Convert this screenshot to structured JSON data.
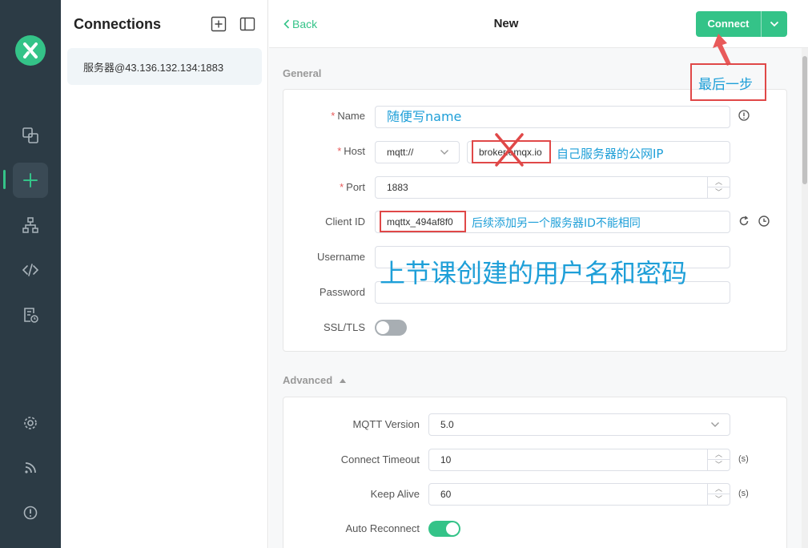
{
  "sidebar": {
    "icons": [
      "logo-icon",
      "connections-icon",
      "new-connection-icon",
      "topology-icon",
      "script-icon",
      "log-icon",
      "settings-icon",
      "subscribe-feed-icon",
      "about-icon"
    ],
    "accent": "#34c388"
  },
  "connections": {
    "title": "Connections",
    "items": [
      {
        "label": "服务器@43.136.132.134:1883"
      }
    ]
  },
  "header": {
    "back_label": "Back",
    "title": "New",
    "connect_label": "Connect"
  },
  "general": {
    "section_label": "General",
    "name": {
      "label": "Name",
      "value": "随便写name"
    },
    "host": {
      "label": "Host",
      "protocol": "mqtt://",
      "value": "broker.emqx.io"
    },
    "port": {
      "label": "Port",
      "value": "1883"
    },
    "client_id": {
      "label": "Client ID",
      "value": "mqttx_494af8f0"
    },
    "username": {
      "label": "Username",
      "value": ""
    },
    "password": {
      "label": "Password",
      "value": ""
    },
    "ssl": {
      "label": "SSL/TLS",
      "enabled": false
    }
  },
  "advanced": {
    "section_label": "Advanced",
    "mqtt_version": {
      "label": "MQTT Version",
      "value": "5.0"
    },
    "connect_timeout": {
      "label": "Connect Timeout",
      "value": "10",
      "unit": "(s)"
    },
    "keep_alive": {
      "label": "Keep Alive",
      "value": "60",
      "unit": "(s)"
    },
    "auto_reconnect": {
      "label": "Auto Reconnect",
      "enabled": true
    }
  },
  "annotations": {
    "last_step": "最后一步",
    "host_note": "自己服务器的公网IP",
    "client_id_note": "后续添加另一个服务器ID不能相同",
    "credentials_note": "上节课创建的用户名和密码"
  },
  "colors": {
    "accent": "#34c388",
    "sidebar_bg": "#2c3b45",
    "annotation_red": "#e04848",
    "annotation_blue": "#1e9fd8"
  }
}
